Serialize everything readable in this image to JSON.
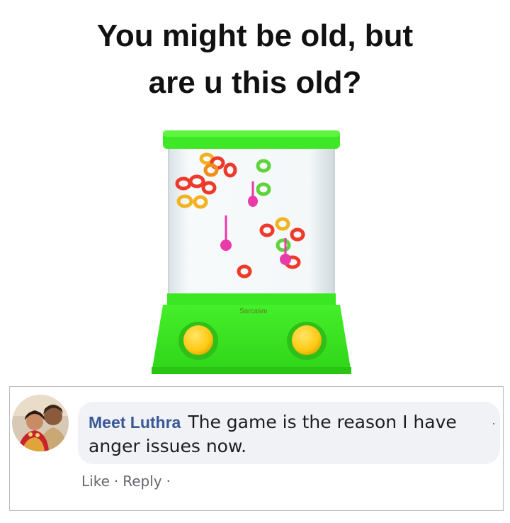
{
  "headline": {
    "line1": "You might be old, but",
    "line2": "are u this old?"
  },
  "image": {
    "subject": "water-ring-toss-game-icon",
    "watermark": "Sarcasm",
    "colors": {
      "body": "#39e61f",
      "button": "#ffd21a",
      "water": "#eef3f4"
    }
  },
  "comment": {
    "author": "Meet Luthra",
    "text": "The game is the reason I have anger issues now.",
    "more": "·",
    "actions": {
      "like": "Like",
      "separator": "·",
      "reply": "Reply",
      "trailing": "·"
    }
  }
}
